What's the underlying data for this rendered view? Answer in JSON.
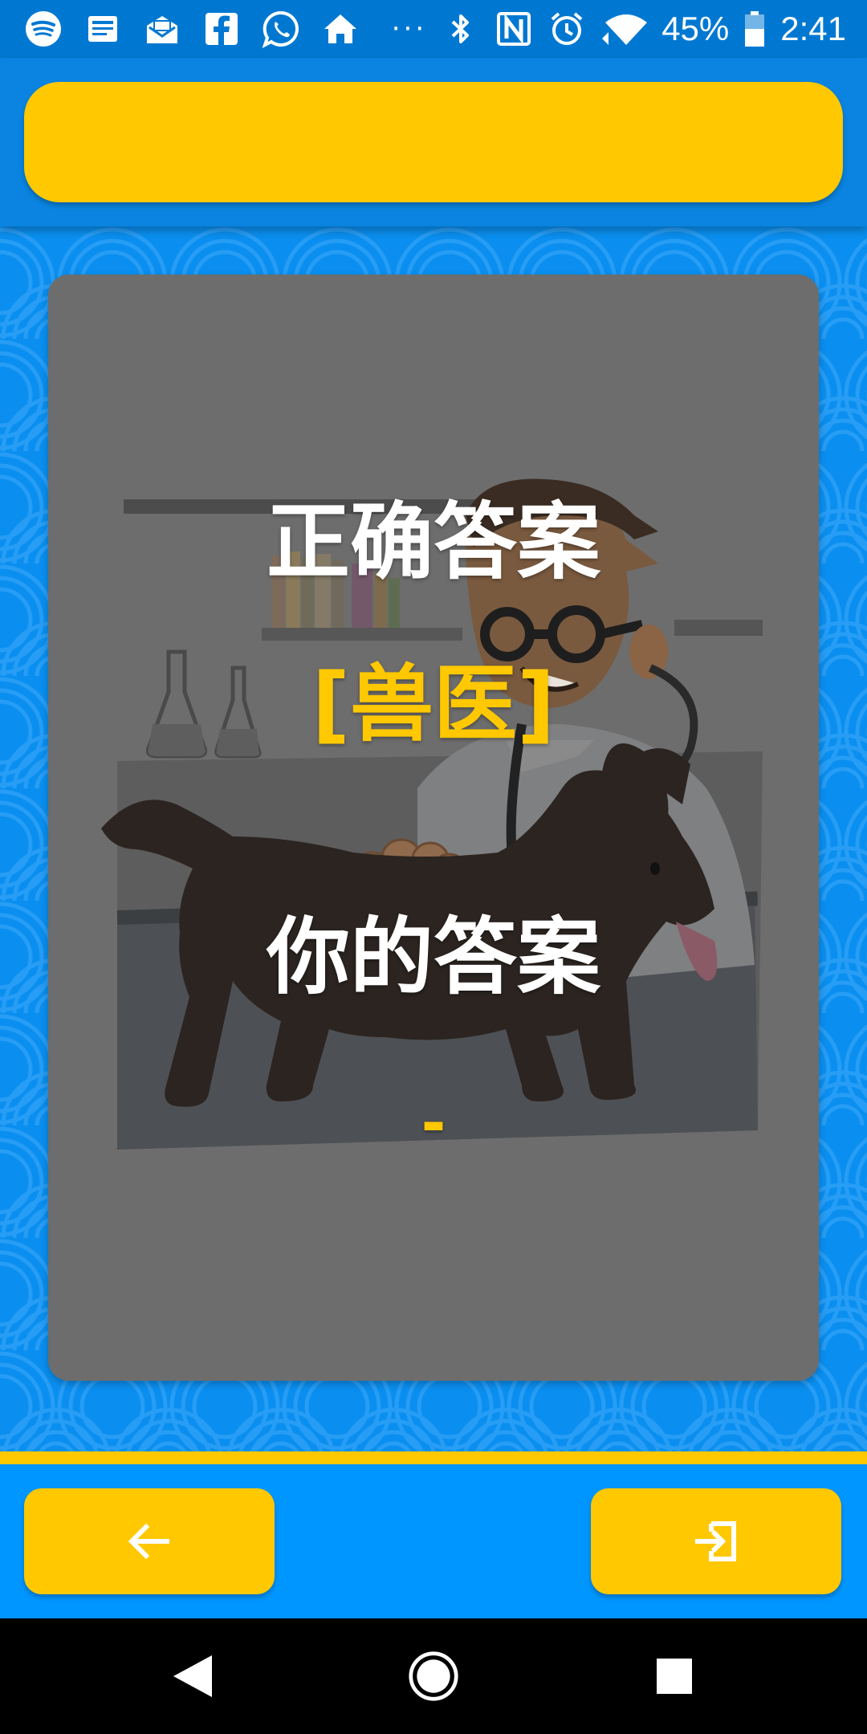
{
  "status_bar": {
    "notification_icons": [
      "spotify-icon",
      "news-icon",
      "mail-icon",
      "facebook-icon",
      "whatsapp-icon",
      "home-icon"
    ],
    "overflow": "···",
    "system_icons": [
      "bluetooth-icon",
      "nfc-icon",
      "alarm-icon",
      "wifi-icon",
      "battery-icon"
    ],
    "battery_percent": "45%",
    "time": "2:41"
  },
  "header": {
    "title": ""
  },
  "result_card": {
    "correct_answer_label": "正确答案",
    "correct_answer": "[兽医]",
    "your_answer_label": "你的答案",
    "your_answer": "-",
    "image_subject": "veterinarian examining a dog"
  },
  "bottom_bar": {
    "back_icon": "arrow-left-icon",
    "exit_icon": "exit-icon"
  },
  "system_nav": {
    "icons": [
      "back-triangle-icon",
      "home-circle-icon",
      "recents-square-icon"
    ]
  },
  "colors": {
    "accent": "#ffc800",
    "primary_blue": "#0a8ff0",
    "status_bar": "#0078d2",
    "card_overlay": "#6c6c6c"
  }
}
